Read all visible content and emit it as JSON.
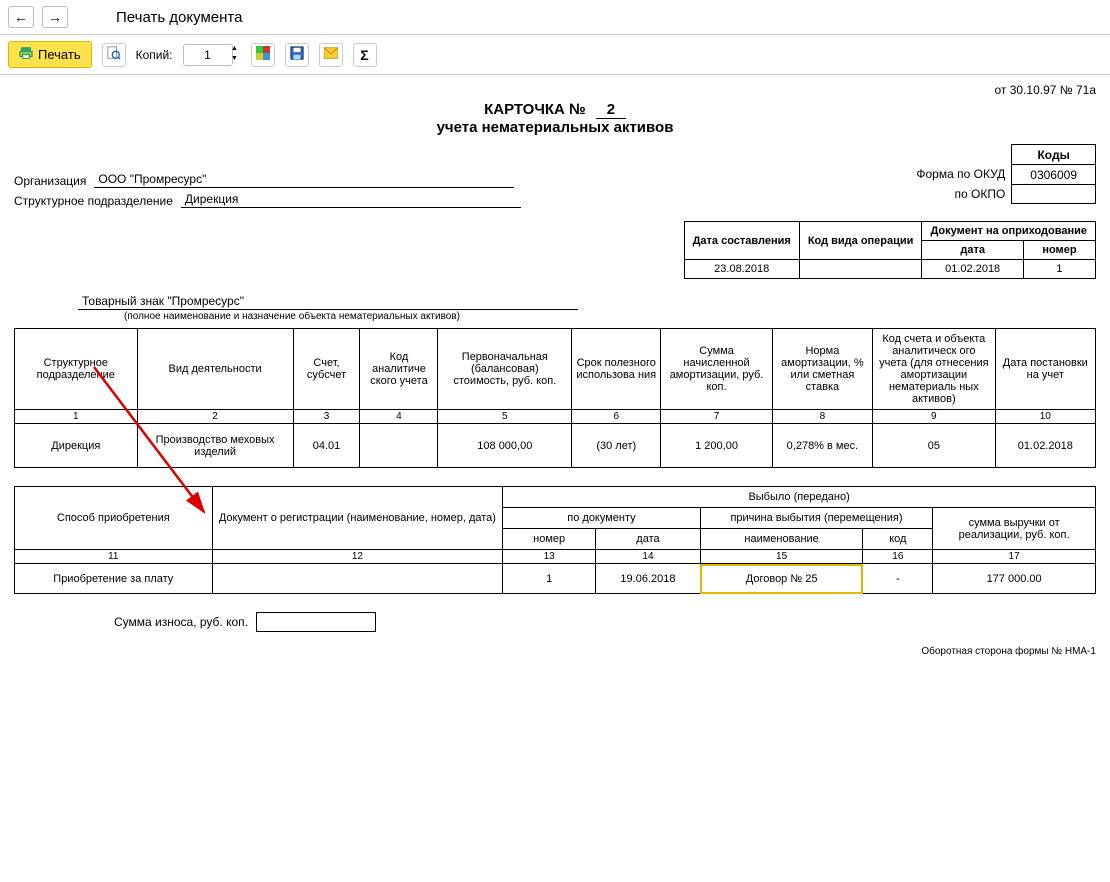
{
  "titlebar": {
    "title": "Печать документа"
  },
  "toolbar": {
    "print_label": "Печать",
    "copies_label": "Копий:",
    "copies_value": "1"
  },
  "doc": {
    "topright": "от 30.10.97 № 71а",
    "card_label": "КАРТОЧКА №",
    "card_no": "2",
    "card_sub": "учета нематериальных активов",
    "codes_header": "Коды",
    "okud_label": "Форма по ОКУД",
    "okud": "0306009",
    "okpo_label": "по ОКПО",
    "okpo": "",
    "org_label": "Организация",
    "org_value": "ООО \"Промресурс\"",
    "dept_label": "Структурное подразделение",
    "dept_value": "Дирекция",
    "meta": {
      "h1": "Дата составления",
      "h2": "Код вида операции",
      "h3": "Документ на оприходование",
      "h3a": "дата",
      "h3b": "номер",
      "date_made": "23.08.2018",
      "op_code": "",
      "doc_date": "01.02.2018",
      "doc_no": "1"
    },
    "asset_name": "Товарный знак \"Промресурс\"",
    "asset_hint": "(полное наименование и назначение объекта нематериальных активов)",
    "table1": {
      "headers": [
        "Структурное подразделение",
        "Вид деятельности",
        "Счет, субсчет",
        "Код аналитиче ского учета",
        "Первоначальная (балансовая) стоимость, руб. коп.",
        "Срок полезного использова ния",
        "Сумма начисленной амортизации, руб. коп.",
        "Норма амортизации, % или сметная ставка",
        "Код счета и объекта аналитическ ого учета (для отнесения амортизации нематериаль ных активов)",
        "Дата постановки на учет"
      ],
      "nums": [
        "1",
        "2",
        "3",
        "4",
        "5",
        "6",
        "7",
        "8",
        "9",
        "10"
      ],
      "row": {
        "c1": "Дирекция",
        "c2": "Производство меховых изделий",
        "c3": "04.01",
        "c4": "",
        "c5": "108 000,00",
        "c6": "(30 лет)",
        "c7": "1 200,00",
        "c8": "0,278% в мес.",
        "c9": "05",
        "c10": "01.02.2018"
      }
    },
    "table2": {
      "h_acq": "Способ приобретения",
      "h_reg": "Документ о регистрации (наименование, номер, дата)",
      "h_ret": "Выбыло (передано)",
      "h_bydoc": "по документу",
      "h_reason": "причина выбытия (перемещения)",
      "h_revenue": "сумма выручки от реализации, руб. коп.",
      "h_no": "номер",
      "h_date": "дата",
      "h_name": "наименование",
      "h_code": "код",
      "nums": [
        "11",
        "12",
        "13",
        "14",
        "15",
        "16",
        "17"
      ],
      "row": {
        "c11": "Приобретение за плату",
        "c12": "",
        "c13": "1",
        "c14": "19.06.2018",
        "c15": "Договор № 25",
        "c16": "-",
        "c17": "177 000.00"
      }
    },
    "wear_label": "Сумма износа, руб. коп.",
    "footer": "Оборотная сторона формы № НМА-1"
  }
}
